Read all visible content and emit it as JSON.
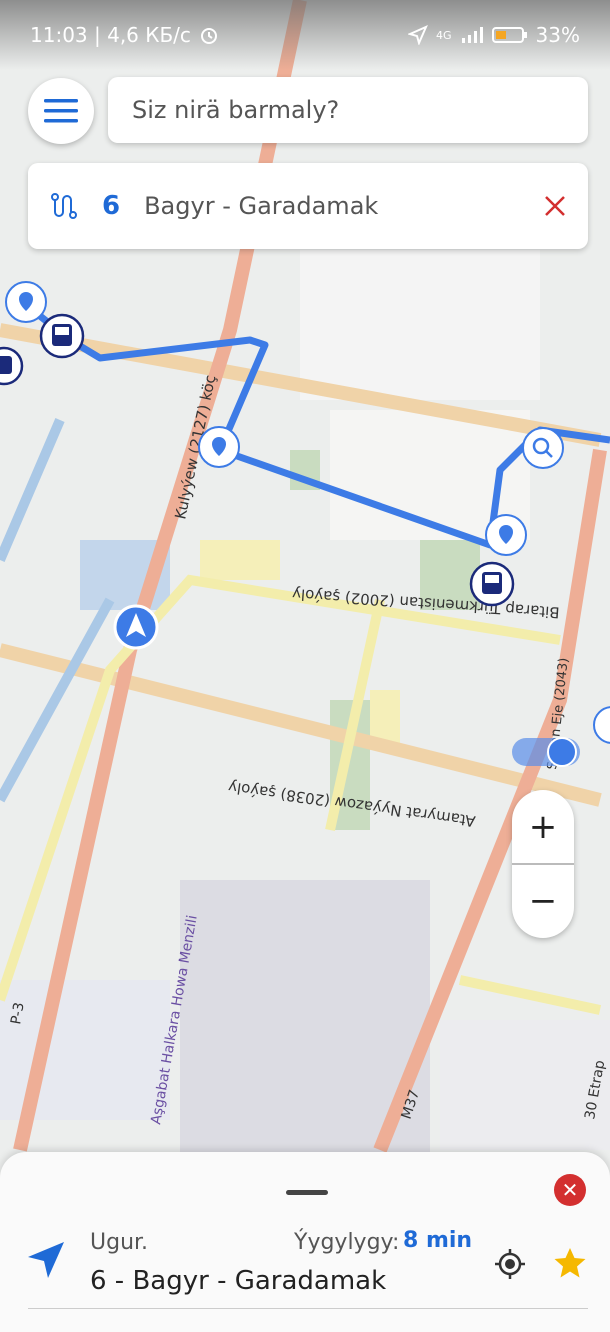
{
  "status_bar": {
    "time_and_speed": "11:03 | 4,6 КБ/с",
    "network": "4G",
    "battery": "33%"
  },
  "search": {
    "placeholder": "Siz nirä barmaly?"
  },
  "route": {
    "number": "6",
    "name": "Bagyr - Garadamak"
  },
  "map_labels": {
    "kulyyew": "Kulyýew (2127) köç",
    "bitarap": "Bitarap Türkmenistan (2002) şaýoly",
    "niyazow": "Atamyrat Nyýazow (2038) şaýoly",
    "airport": "Aşgabat Halkara Howa Menzili",
    "m37": "M37",
    "p3": "P-3",
    "etrap": "30 Etrap",
    "soltan": "Soltan Eje (2043)"
  },
  "zoom": {
    "in": "+",
    "out": "−"
  },
  "sheet": {
    "direction_label": "Ugur.",
    "duration_label": "Ýygylygy:",
    "duration_value": "8 min",
    "title": "6 - Bagyr - Garadamak"
  },
  "colors": {
    "accent": "#1f6ad6",
    "route": "#3d7be6",
    "danger": "#d32f2f",
    "star": "#f5b800"
  }
}
